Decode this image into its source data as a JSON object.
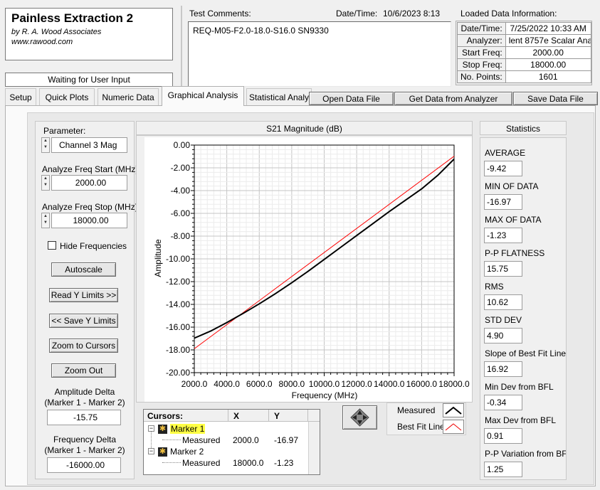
{
  "app": {
    "title": "Painless Extraction 2",
    "author": "by R. A. Wood Associates",
    "website": "www.rawood.com",
    "status": "Waiting for User Input"
  },
  "comments": {
    "label": "Test Comments:",
    "text": "REQ-M05-F2.0-18.0-S16.0  SN9330",
    "datetime_label": "Date/Time:",
    "datetime_value": "10/6/2023  8:13"
  },
  "loaded_data": {
    "title": "Loaded Data Information:",
    "rows": [
      {
        "key": "Date/Time:",
        "value": "7/25/2022 10:33 AM"
      },
      {
        "key": "Analyzer:",
        "value": "lent 8757e Scalar Analy"
      },
      {
        "key": "Start Freq:",
        "value": "2000.00"
      },
      {
        "key": "Stop Freq:",
        "value": "18000.00"
      },
      {
        "key": "No. Points:",
        "value": "1601"
      }
    ]
  },
  "toolbar": {
    "open_label": "Open Data File",
    "get_label": "Get Data from Analyzer",
    "save_label": "Save Data File"
  },
  "tabs": [
    {
      "label": "Setup"
    },
    {
      "label": "Quick Plots"
    },
    {
      "label": "Numeric Data"
    },
    {
      "label": "Graphical Analysis",
      "active": true
    },
    {
      "label": "Statistical Analy"
    }
  ],
  "controls": {
    "parameter_label": "Parameter:",
    "parameter_value": "Channel 3 Mag",
    "start_label": "Analyze Freq Start (MHz)",
    "start_value": "2000.00",
    "stop_label": "Analyze Freq Stop (MHz)",
    "stop_value": "18000.00",
    "hide_freq_label": "Hide Frequencies",
    "autoscale_label": "Autoscale",
    "read_y_label": "Read Y Limits >>",
    "save_y_label": "<< Save Y Limits",
    "zoom_cursors_label": "Zoom to Cursors",
    "zoom_out_label": "Zoom Out",
    "amp_delta_label1": "Amplitude Delta",
    "amp_delta_label2": "(Marker 1 - Marker 2)",
    "amp_delta_value": "-15.75",
    "freq_delta_label1": "Frequency Delta",
    "freq_delta_label2": "(Marker 1 - Marker 2)",
    "freq_delta_value": "-16000.00"
  },
  "cursors": {
    "header": "Cursors:",
    "col_x": "X",
    "col_y": "Y",
    "marker1": {
      "name": "Marker 1",
      "sub": "Measured",
      "x": "2000.0",
      "y": "-16.97"
    },
    "marker2": {
      "name": "Marker 2",
      "sub": "Measured",
      "x": "18000.0",
      "y": "-1.23"
    }
  },
  "legend": {
    "measured": "Measured",
    "best_fit": "Best Fit Line"
  },
  "statistics": {
    "title": "Statistics",
    "items": [
      {
        "label": "AVERAGE",
        "value": "-9.42"
      },
      {
        "label": "MIN OF DATA",
        "value": "-16.97"
      },
      {
        "label": "MAX OF DATA",
        "value": "-1.23"
      },
      {
        "label": "P-P FLATNESS",
        "value": "15.75"
      },
      {
        "label": "RMS",
        "value": "10.62"
      },
      {
        "label": "STD DEV",
        "value": "4.90"
      },
      {
        "label": "Slope of Best Fit Line",
        "value": "16.92"
      },
      {
        "label": "Min Dev from BFL",
        "value": "-0.34"
      },
      {
        "label": "Max Dev from BFL",
        "value": "0.91"
      },
      {
        "label": "P-P Variation from BF",
        "value": "1.25"
      }
    ]
  },
  "chart_data": {
    "type": "line",
    "title": "S21 Magnitude (dB)",
    "xlabel": "Frequency (MHz)",
    "ylabel": "Amplitude",
    "xlim": [
      2000,
      18000
    ],
    "ylim": [
      -20,
      0
    ],
    "x_ticks": [
      "2000.0",
      "4000.0",
      "6000.0",
      "8000.0",
      "10000.0",
      "12000.0",
      "14000.0",
      "16000.0",
      "18000.0"
    ],
    "y_ticks": [
      "0.00",
      "-2.00",
      "-4.00",
      "-6.00",
      "-8.00",
      "-10.00",
      "-12.00",
      "-14.00",
      "-16.00",
      "-18.00",
      "-20.00"
    ],
    "grid": true,
    "series": [
      {
        "name": "Measured",
        "color": "#000000",
        "x": [
          2000,
          3000,
          4000,
          5000,
          6000,
          7000,
          8000,
          9000,
          10000,
          11000,
          12000,
          13000,
          14000,
          15000,
          16000,
          17000,
          18000
        ],
        "y": [
          -16.97,
          -16.35,
          -15.6,
          -14.8,
          -13.95,
          -13.05,
          -12.1,
          -11.1,
          -10.05,
          -9.0,
          -7.95,
          -6.9,
          -5.85,
          -4.85,
          -3.85,
          -2.65,
          -1.23
        ]
      },
      {
        "name": "Best Fit Line",
        "color": "#ff0000",
        "x": [
          2000,
          18000
        ],
        "y": [
          -17.9,
          -0.98
        ]
      }
    ]
  }
}
